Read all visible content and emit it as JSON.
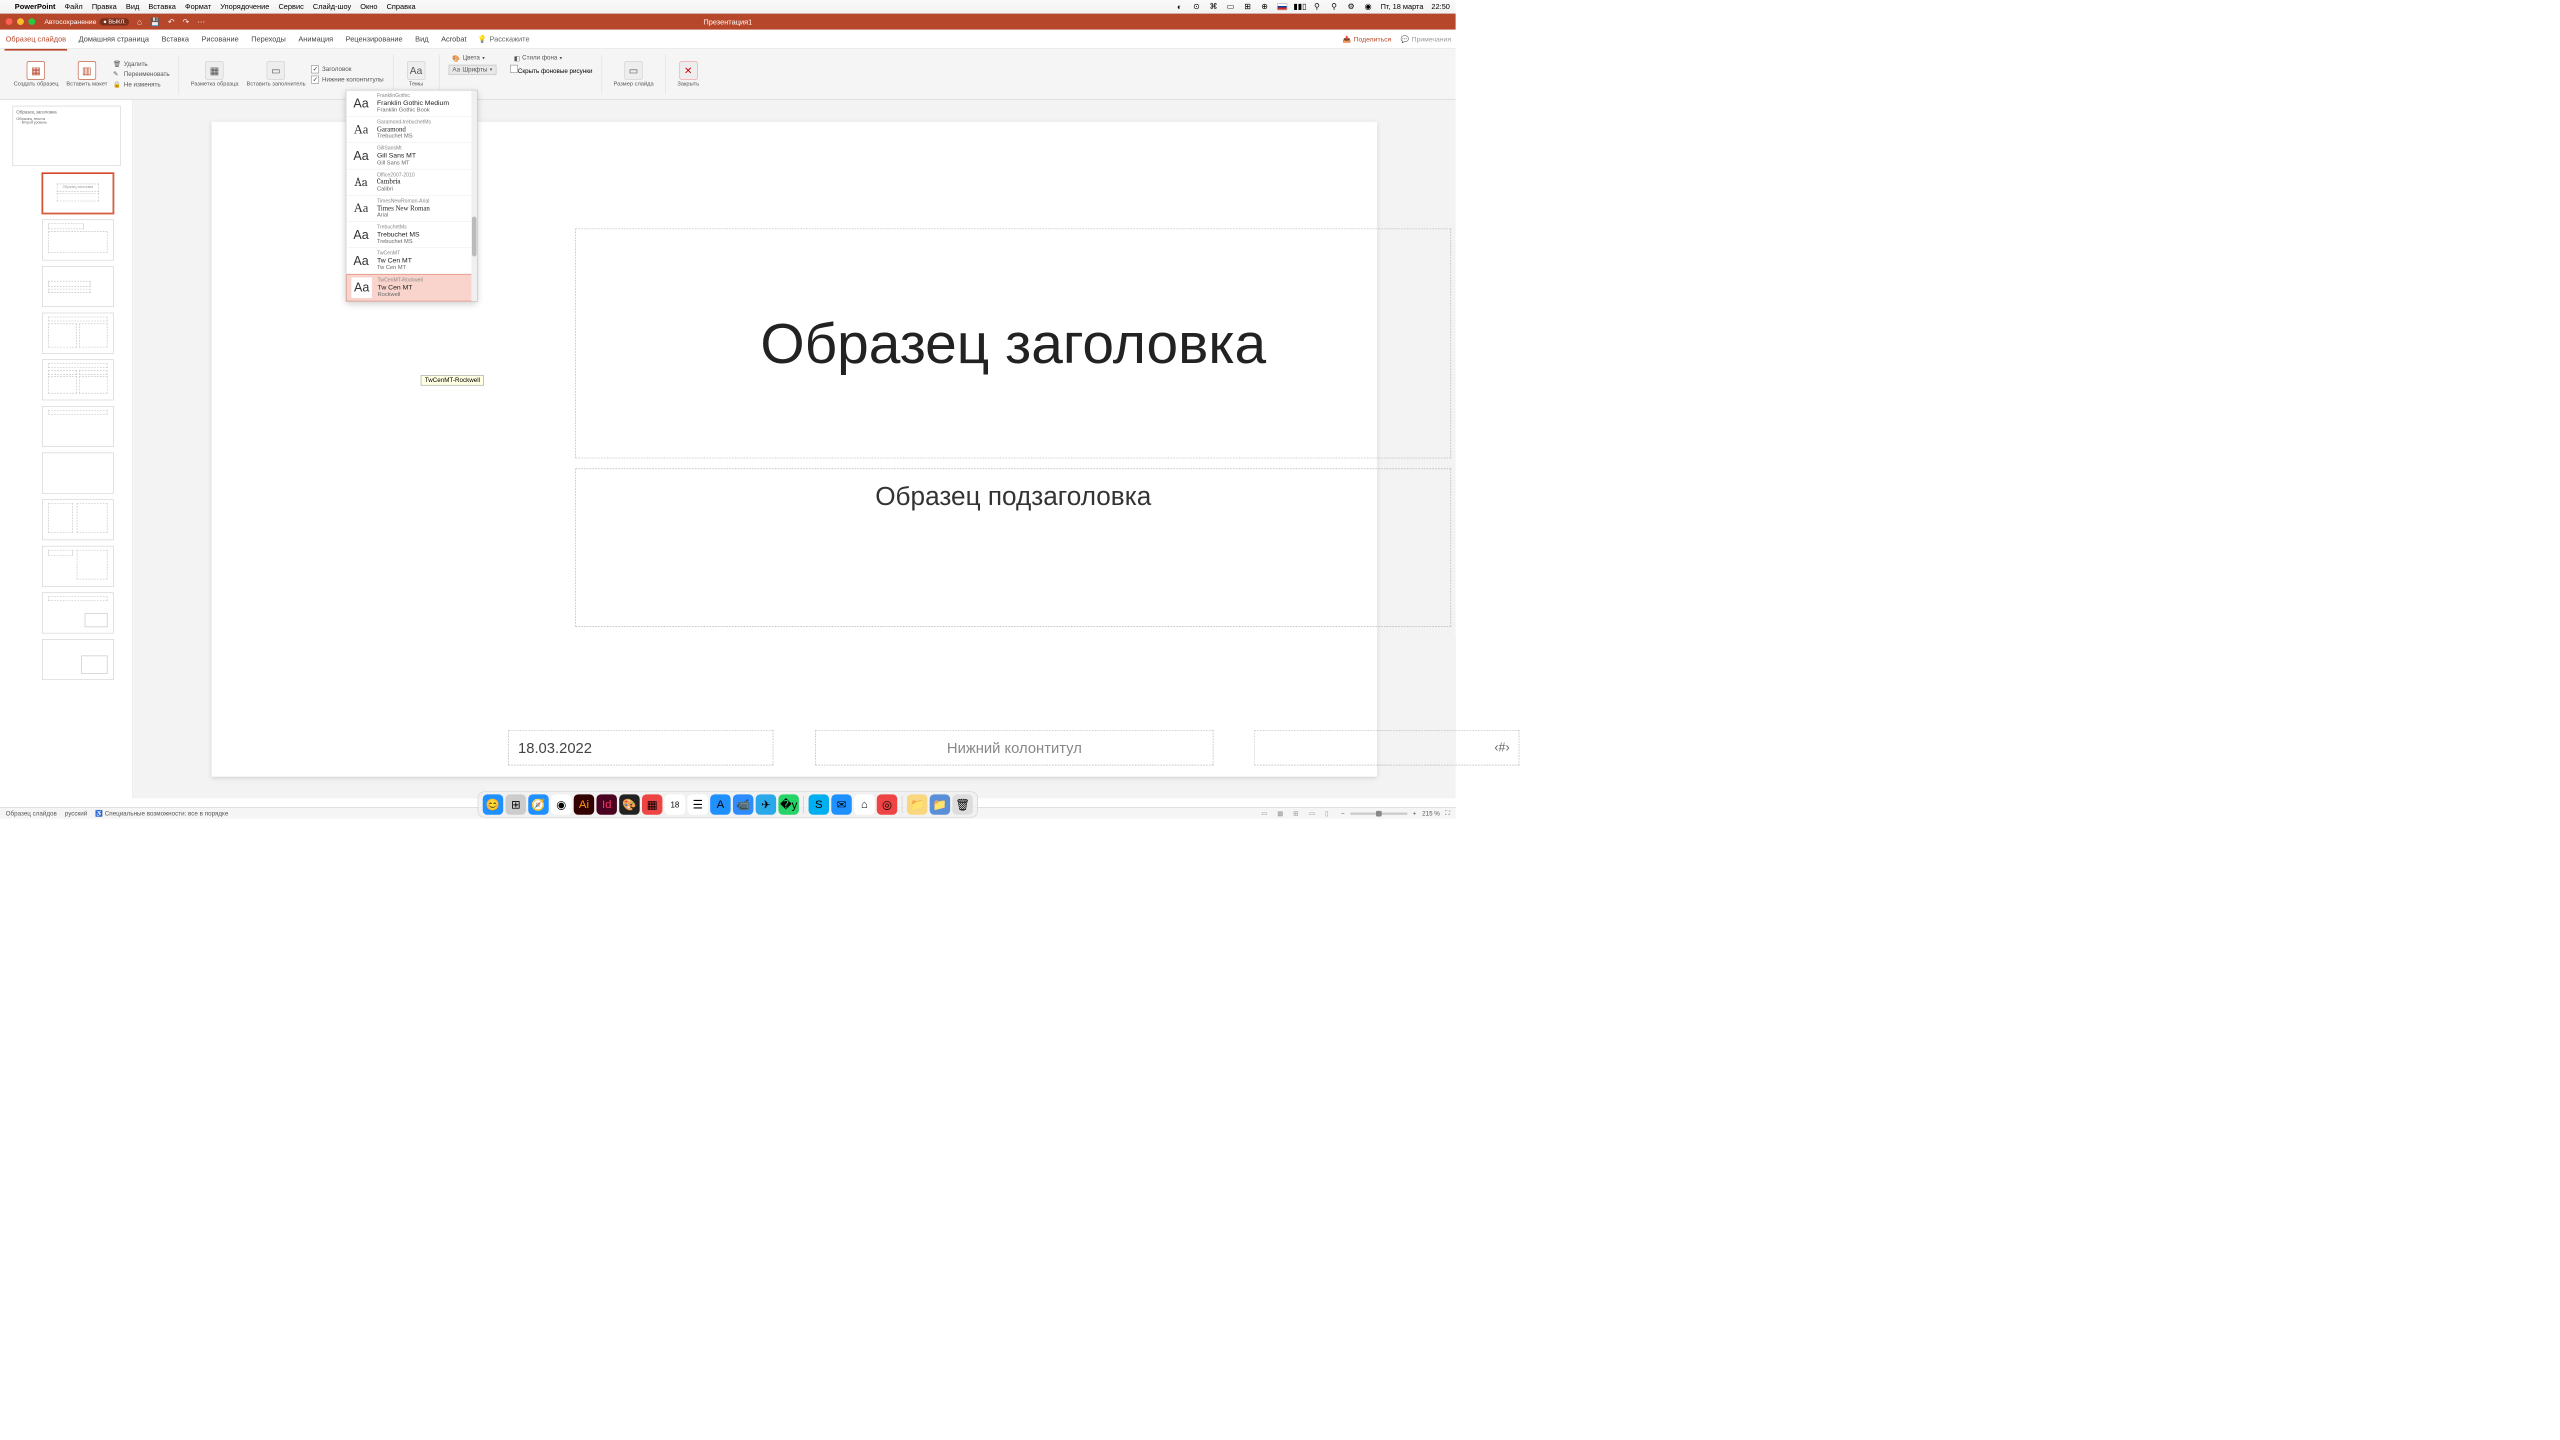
{
  "mac_menu": {
    "app": "PowerPoint",
    "items": [
      "Файл",
      "Правка",
      "Вид",
      "Вставка",
      "Формат",
      "Упорядочение",
      "Сервис",
      "Слайд-шоу",
      "Окно",
      "Справка"
    ],
    "date": "Пт, 18 марта",
    "time": "22:50"
  },
  "titlebar": {
    "autosave": "Автосохранение",
    "autosave_state": "ВЫКЛ.",
    "doc": "Презентация1"
  },
  "ribbon_tabs": [
    "Образец слайдов",
    "Домашняя страница",
    "Вставка",
    "Рисование",
    "Переходы",
    "Анимация",
    "Рецензирование",
    "Вид",
    "Acrobat"
  ],
  "tell_me": "Расскажите",
  "share": "Поделиться",
  "comments": "Примечания",
  "ribbon": {
    "create_master": "Создать образец",
    "insert_layout": "Вставить макет",
    "delete": "Удалить",
    "rename": "Переименовать",
    "preserve": "Не изменять",
    "master_layout": "Разметка образца",
    "insert_ph": "Вставить заполнитель",
    "chk_title": "Заголовок",
    "chk_footers": "Нижние колонтитулы",
    "themes": "Темы",
    "colors": "Цвета",
    "fonts": "Шрифты",
    "bg_styles": "Стили фона",
    "hide_bg": "Скрыть фоновые рисунки",
    "slide_size": "Размер слайда",
    "close": "Закрыть"
  },
  "fonts_list": [
    {
      "group": "FranklinGothic",
      "main": "Franklin Gothic Medium",
      "sub": "Franklin Gothic Book",
      "ff": "'Arial Black',sans-serif"
    },
    {
      "group": "Garamond-trebuchetMs",
      "main": "Garamond",
      "sub": "Trebuchet MS",
      "ff": "Garamond,serif"
    },
    {
      "group": "GillSansMt",
      "main": "Gill Sans MT",
      "sub": "Gill Sans MT",
      "ff": "'Gill Sans',sans-serif"
    },
    {
      "group": "Office2007-2010",
      "main": "Cambria",
      "sub": "Calibri",
      "ff": "Cambria,serif"
    },
    {
      "group": "TimesNewRoman-Arial",
      "main": "Times New Roman",
      "sub": "Arial",
      "ff": "'Times New Roman',serif"
    },
    {
      "group": "TrebuchetMs",
      "main": "Trebuchet MS",
      "sub": "Trebuchet MS",
      "ff": "'Trebuchet MS',sans-serif"
    },
    {
      "group": "TwCenMT",
      "main": "Tw Cen MT",
      "sub": "Tw Cen MT",
      "ff": "sans-serif"
    },
    {
      "group": "TwCenMT-Rockwell",
      "main": "Tw Cen MT",
      "sub": "Rockwell",
      "ff": "sans-serif",
      "selected": true
    }
  ],
  "font_tooltip": "TwCenMT-Rockwell",
  "slide": {
    "title": "Образец заголовка",
    "subtitle": "Образец подзаголовка",
    "date": "18.03.2022",
    "footer": "Нижний колонтитул",
    "pagenum": "‹#›"
  },
  "thumb_labels": {
    "master_title": "Образец заголовка",
    "bullet1": "Образец текста",
    "bullet2": "· Второй уровень"
  },
  "status": {
    "mode": "Образец слайдов",
    "lang": "русский",
    "a11y": "Специальные возможности: все в порядке",
    "zoom": "215 %"
  }
}
